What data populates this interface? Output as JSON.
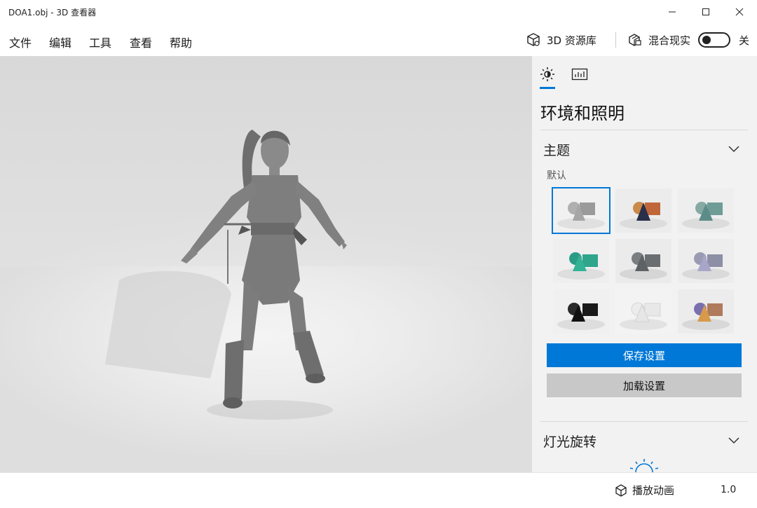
{
  "window": {
    "title": "DOA1.obj - 3D 查看器"
  },
  "menu": {
    "items": [
      "文件",
      "编辑",
      "工具",
      "查看",
      "帮助"
    ],
    "library_label": "3D 资源库",
    "mixed_reality_label": "混合现实",
    "toggle_state": "关"
  },
  "panel": {
    "tabs": [
      {
        "icon": "sun-icon",
        "active": true
      },
      {
        "icon": "stats-icon",
        "active": false
      }
    ],
    "title": "环境和照明",
    "theme_section": {
      "heading": "主题",
      "selected_name": "默认"
    },
    "save_label": "保存设置",
    "load_label": "加载设置",
    "light_section": {
      "heading": "灯光旋转"
    }
  },
  "bottom": {
    "anim_label": "播放动画",
    "extra_text": "1.0"
  },
  "colors": {
    "accent": "#0078d7",
    "panel_bg": "#f2f2f2",
    "load_button_bg": "#c8c8c8"
  }
}
